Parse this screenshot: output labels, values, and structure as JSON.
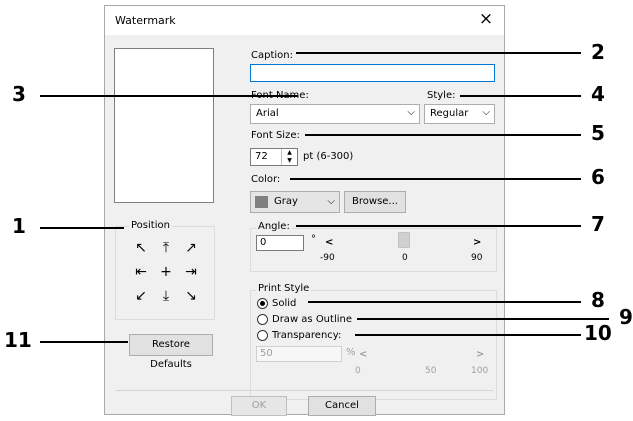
{
  "dialog": {
    "title": "Watermark",
    "close_glyph": "×"
  },
  "caption": {
    "label": "Caption:",
    "value": ""
  },
  "font_name": {
    "label": "Font Name:",
    "value": "Arial"
  },
  "style": {
    "label": "Style:",
    "value": "Regular"
  },
  "font_size": {
    "label": "Font Size:",
    "value": "72",
    "range": "pt (6-300)"
  },
  "color": {
    "label": "Color:",
    "value": "Gray",
    "swatch_color": "#808080",
    "browse_label": "Browse..."
  },
  "angle": {
    "label": "Angle:",
    "value": "0",
    "degree_glyph": "°",
    "left_arrow": "<",
    "right_arrow": ">",
    "min": "-90",
    "mid": "0",
    "max": "90"
  },
  "position": {
    "label": "Position",
    "arrows": [
      "↖",
      "⤒",
      "↗",
      "⇤",
      "+",
      "⇥",
      "↙",
      "⤓",
      "↘"
    ]
  },
  "print_style": {
    "label": "Print Style",
    "options": [
      {
        "label": "Solid",
        "checked": true
      },
      {
        "label": "Draw as Outline",
        "checked": false
      },
      {
        "label": "Transparency:",
        "checked": false
      }
    ],
    "transparency_value": "50",
    "percent": "%",
    "left_arrow": "<",
    "right_arrow": ">",
    "min": "0",
    "mid": "50",
    "max": "100"
  },
  "restore_defaults_label": "Restore Defaults",
  "ok_label": "OK",
  "cancel_label": "Cancel",
  "callouts": [
    "1",
    "2",
    "3",
    "4",
    "5",
    "6",
    "7",
    "8",
    "9",
    "10",
    "11"
  ]
}
